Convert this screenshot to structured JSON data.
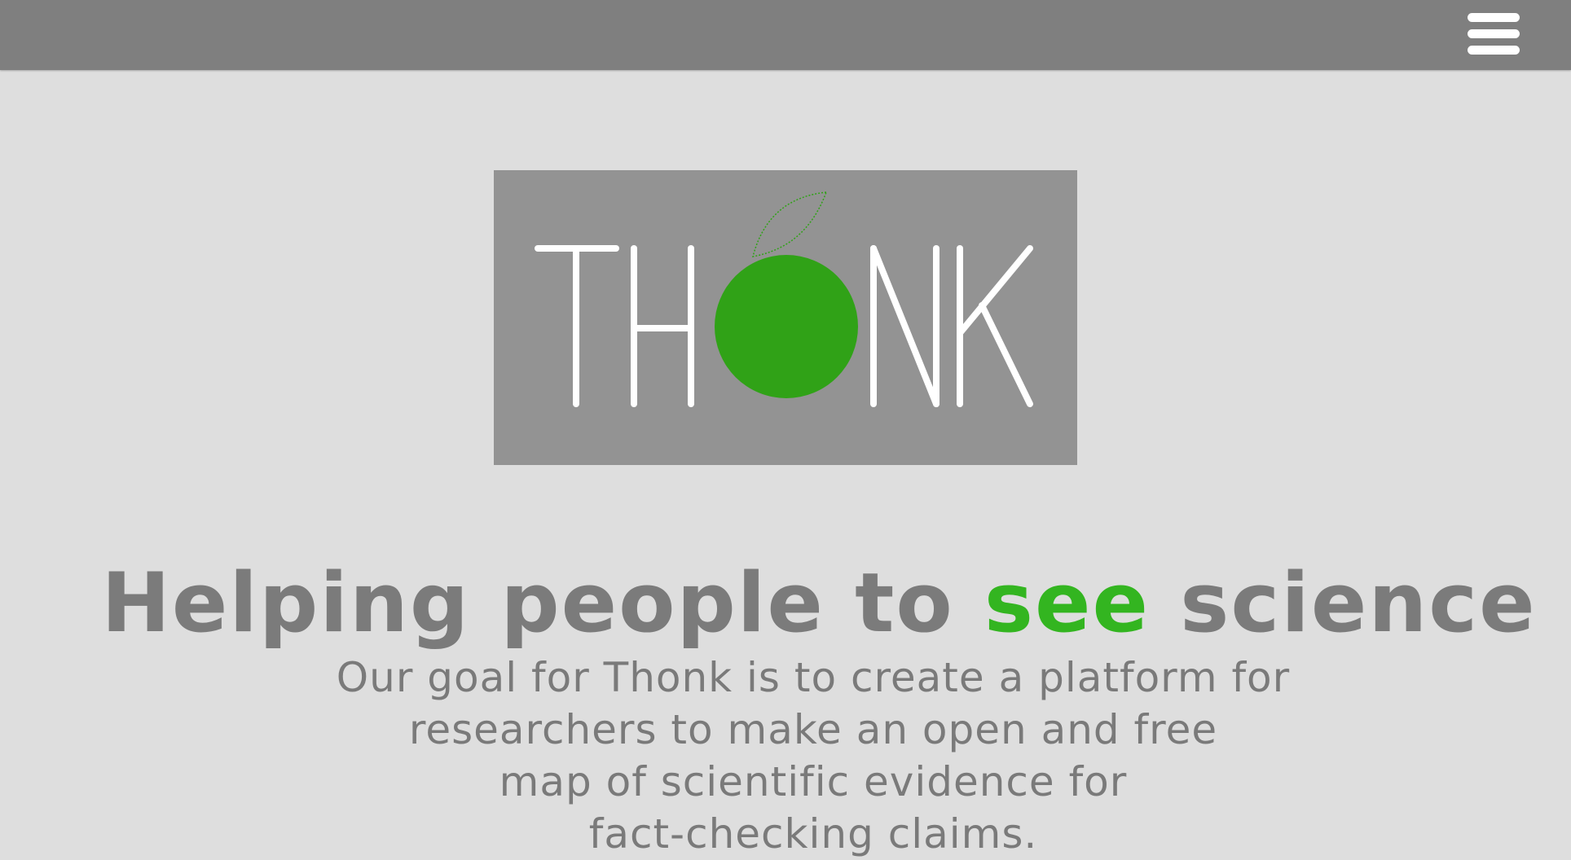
{
  "brand": {
    "logo_text_left": "TH",
    "logo_text_right": "NK",
    "accent_color": "#30a217",
    "logo_background": "#939393"
  },
  "navbar": {
    "menu_icon": "hamburger-menu-icon",
    "background": "#7f7f7f"
  },
  "hero": {
    "headline_before": "Helping people to ",
    "headline_accent": "see",
    "headline_after": " science",
    "description_lines": [
      "Our goal for Thonk is to create a platform for",
      "researchers to make an open and free",
      "map of scientific evidence for",
      "fact-checking claims."
    ]
  }
}
